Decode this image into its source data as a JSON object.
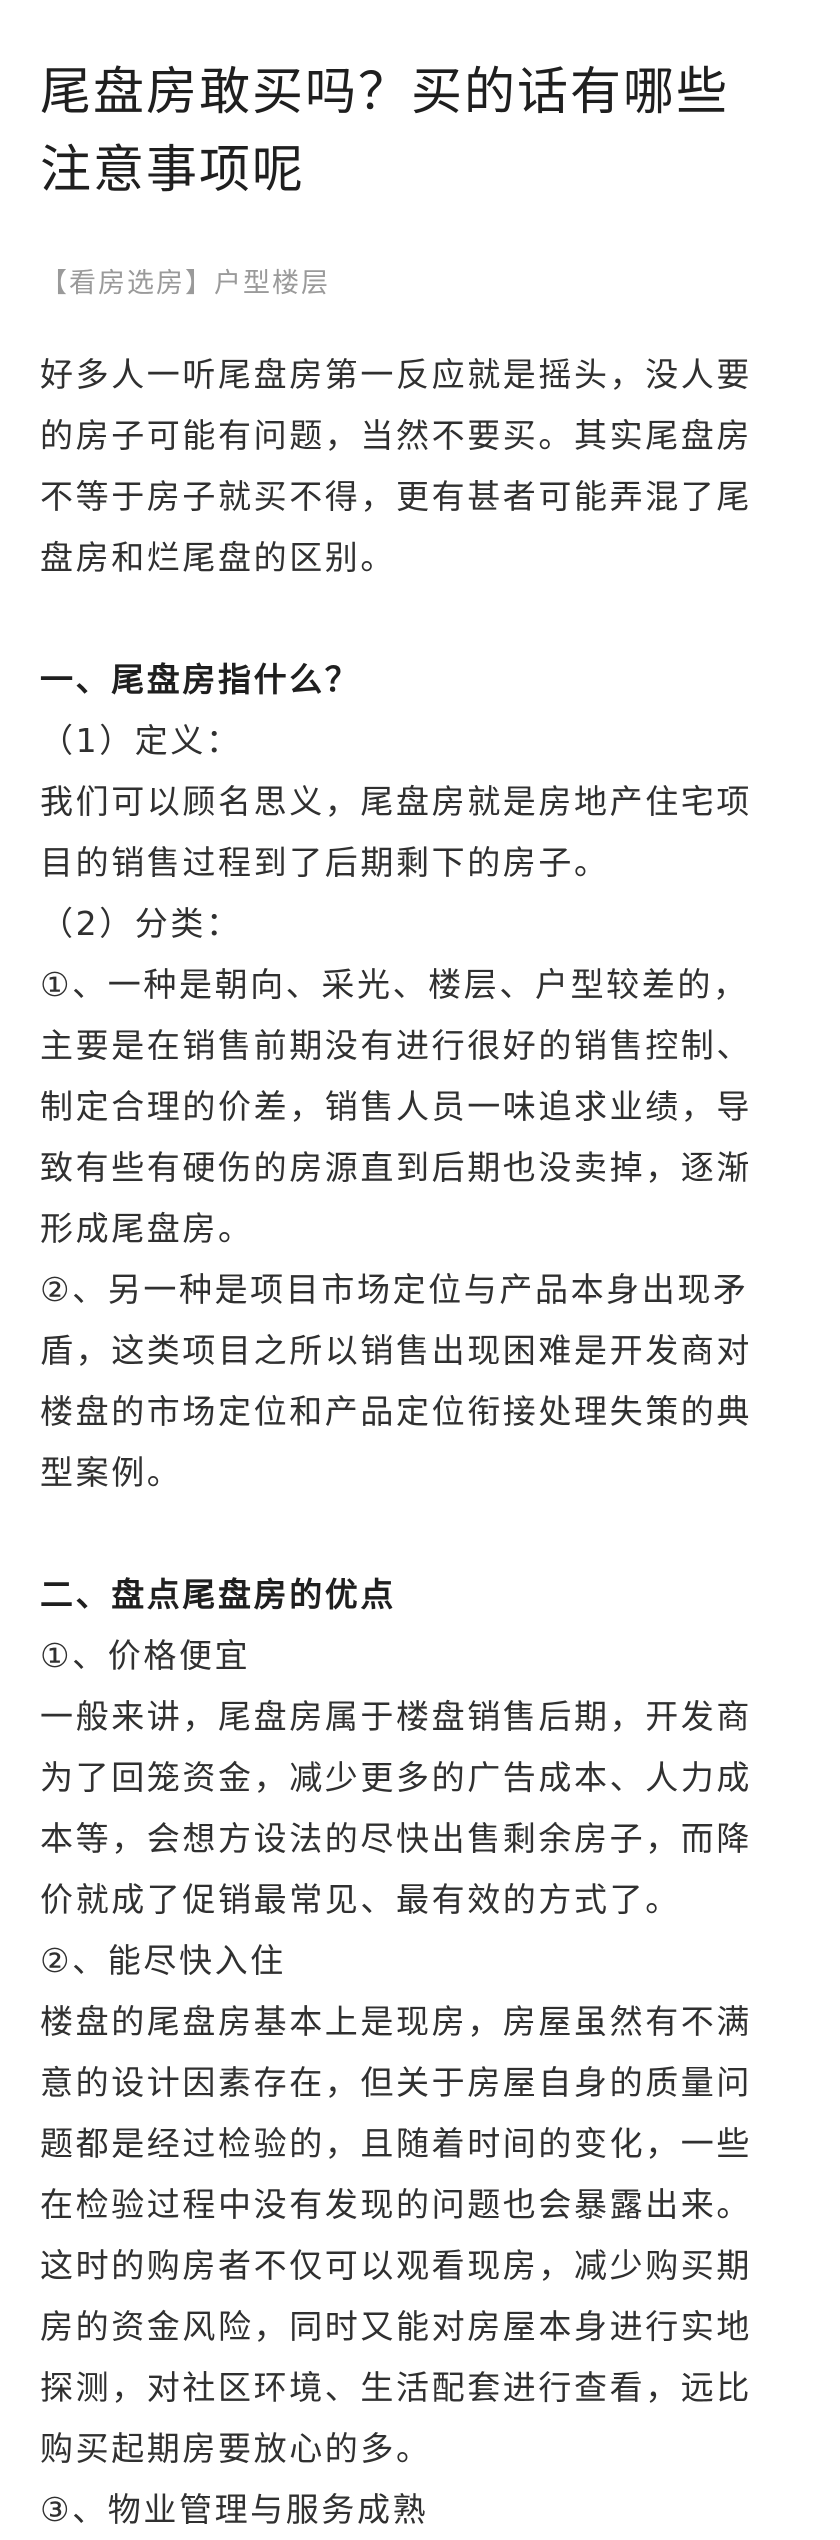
{
  "article": {
    "title_lines": [
      "尾盘房敢买吗？买的话有哪些",
      "注意事项呢"
    ],
    "category": "【看房选房】户型楼层",
    "intro_lines": [
      "好多人一听尾盘房第一反应就是摇头，没人要",
      "的房子可能有问题，当然不要买。其实尾盘房",
      "不等于房子就买不得，更有甚者可能弄混了尾",
      "盘房和烂尾盘的区别。"
    ],
    "section1": {
      "heading": "一、尾盘房指什么？",
      "def_label": "（1）定义：",
      "def_lines": [
        "我们可以顾名思义，尾盘房就是房地产住宅项",
        "目的销售过程到了后期剩下的房子。"
      ],
      "cls_label": "（2）分类：",
      "cls1_lines": [
        "①、一种是朝向、采光、楼层、户型较差的，",
        "主要是在销售前期没有进行很好的销售控制、",
        "制定合理的价差，销售人员一味追求业绩，导",
        "致有些有硬伤的房源直到后期也没卖掉，逐渐",
        "形成尾盘房。"
      ],
      "cls2_lines": [
        "②、另一种是项目市场定位与产品本身出现矛",
        "盾，这类项目之所以销售出现困难是开发商对",
        "楼盘的市场定位和产品定位衔接处理失策的典",
        "型案例。"
      ]
    },
    "section2": {
      "heading": "二、盘点尾盘房的优点",
      "adv1_label": "①、价格便宜",
      "adv1_lines": [
        "一般来讲，尾盘房属于楼盘销售后期，开发商",
        "为了回笼资金，减少更多的广告成本、人力成",
        "本等，会想方设法的尽快出售剩余房子，而降",
        "价就成了促销最常见、最有效的方式了。"
      ],
      "adv2_label": "②、能尽快入住",
      "adv2_lines": [
        "楼盘的尾盘房基本上是现房，房屋虽然有不满",
        "意的设计因素存在，但关于房屋自身的质量问",
        "题都是经过检验的，且随着时间的变化，一些",
        "在检验过程中没有发现的问题也会暴露出来。",
        "这时的购房者不仅可以观看现房，减少购买期",
        "房的资金风险，同时又能对房屋本身进行实地",
        "探测，对社区环境、生活配套进行查看，远比",
        "购买起期房要放心的多。"
      ],
      "adv3_label": "③、物业管理与服务成熟"
    }
  }
}
